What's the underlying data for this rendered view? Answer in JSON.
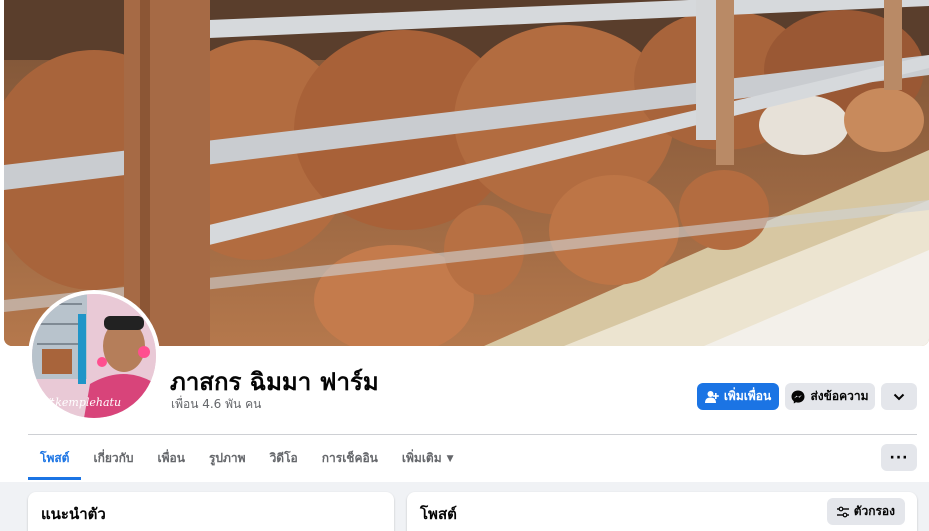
{
  "profile": {
    "name": "ภาสกร ฉิมมา ฟาร์ม",
    "friends_text": "เพื่อน 4.6 พัน คน",
    "avatar_watermark": "#kemplehatu"
  },
  "actions": {
    "add_friend_label": "เพิ่มเพื่อน",
    "message_label": "ส่งข้อความ",
    "more_icon": "chevron-down-icon"
  },
  "tabs": [
    {
      "label": "โพสต์",
      "active": true
    },
    {
      "label": "เกี่ยวกับ",
      "active": false
    },
    {
      "label": "เพื่อน",
      "active": false
    },
    {
      "label": "รูปภาพ",
      "active": false
    },
    {
      "label": "วิดีโอ",
      "active": false
    },
    {
      "label": "การเช็คอิน",
      "active": false
    },
    {
      "label": "เพิ่มเติม",
      "active": false
    }
  ],
  "tabs_more_label": "···",
  "intro_card": {
    "title": "แนะนำตัว"
  },
  "posts_card": {
    "title": "โพสต์",
    "filter_label": "ตัวกรอง"
  },
  "colors": {
    "accent": "#1b74e4",
    "secondary_button": "#e4e6eb",
    "page_background": "#f0f2f5",
    "text_primary": "#050505",
    "text_secondary": "#65676b"
  }
}
